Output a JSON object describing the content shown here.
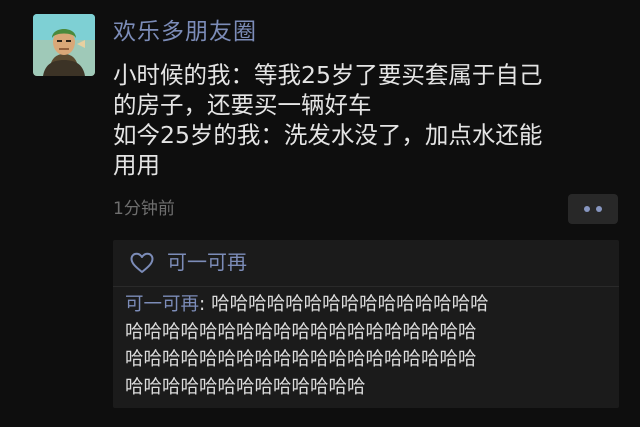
{
  "post": {
    "author": "欢乐多朋友圈",
    "text_lines": [
      "小时候的我：等我25岁了要买套属于自己",
      "的房子，还要买一辆好车",
      "如今25岁的我：洗发水没了，加点水还能",
      "用用"
    ],
    "time": "1分钟前"
  },
  "avatar_icon": "cartoon-character-portrait",
  "more_icon": "two-dots-icon",
  "likes": {
    "icon": "heart-outline-icon",
    "names": "可一可再"
  },
  "comment": {
    "author": "可一可再",
    "separator": ": ",
    "text_lines": [
      "哈哈哈哈哈哈哈哈哈哈哈哈哈哈哈",
      "哈哈哈哈哈哈哈哈哈哈哈哈哈哈哈哈哈哈哈",
      "哈哈哈哈哈哈哈哈哈哈哈哈哈哈哈哈哈哈哈",
      "哈哈哈哈哈哈哈哈哈哈哈哈哈"
    ]
  },
  "colors": {
    "background": "#0e0e0e",
    "link": "#7c8cb8",
    "text": "#e4e4e4",
    "muted": "#6e6e6e",
    "panel": "#1b1b1b"
  }
}
